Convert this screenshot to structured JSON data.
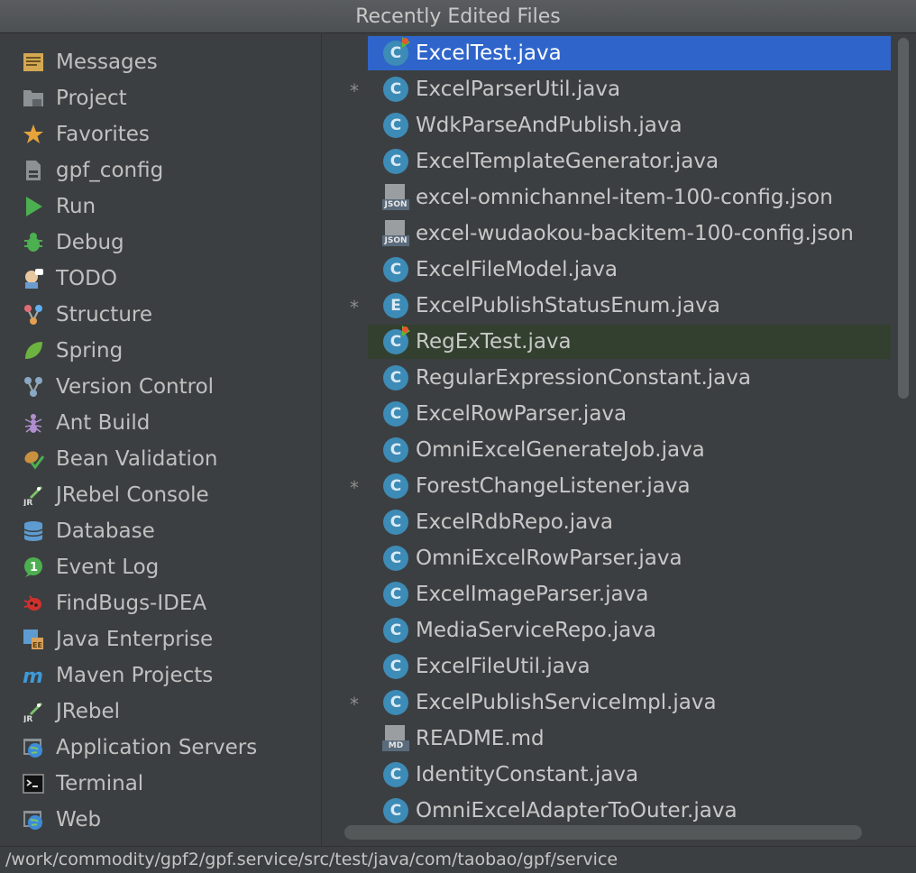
{
  "window": {
    "title": "Recently Edited Files"
  },
  "tool_windows": [
    {
      "label": "Messages",
      "icon": "messages-icon"
    },
    {
      "label": "Project",
      "icon": "project-icon"
    },
    {
      "label": "Favorites",
      "icon": "favorites-star-icon"
    },
    {
      "label": "gpf_config",
      "icon": "database-file-icon"
    },
    {
      "label": "Run",
      "icon": "run-icon"
    },
    {
      "label": "Debug",
      "icon": "debug-bug-icon"
    },
    {
      "label": "TODO",
      "icon": "todo-icon"
    },
    {
      "label": "Structure",
      "icon": "structure-icon"
    },
    {
      "label": "Spring",
      "icon": "spring-leaf-icon"
    },
    {
      "label": "Version Control",
      "icon": "version-control-icon"
    },
    {
      "label": "Ant Build",
      "icon": "ant-icon"
    },
    {
      "label": "Bean Validation",
      "icon": "bean-validation-icon"
    },
    {
      "label": "JRebel Console",
      "icon": "jrebel-console-icon"
    },
    {
      "label": "Database",
      "icon": "database-icon"
    },
    {
      "label": "Event Log",
      "icon": "event-log-icon"
    },
    {
      "label": "FindBugs-IDEA",
      "icon": "findbugs-icon"
    },
    {
      "label": "Java Enterprise",
      "icon": "java-enterprise-icon"
    },
    {
      "label": "Maven Projects",
      "icon": "maven-icon"
    },
    {
      "label": "JRebel",
      "icon": "jrebel-icon"
    },
    {
      "label": "Application Servers",
      "icon": "application-servers-icon"
    },
    {
      "label": "Terminal",
      "icon": "terminal-icon"
    },
    {
      "label": "Web",
      "icon": "web-icon"
    }
  ],
  "files": [
    {
      "name": "ExcelTest.java",
      "kind": "class-run",
      "modified": false,
      "state": "selected"
    },
    {
      "name": "ExcelParserUtil.java",
      "kind": "class",
      "modified": true,
      "state": ""
    },
    {
      "name": "WdkParseAndPublish.java",
      "kind": "class",
      "modified": false,
      "state": ""
    },
    {
      "name": "ExcelTemplateGenerator.java",
      "kind": "class",
      "modified": false,
      "state": ""
    },
    {
      "name": "excel-omnichannel-item-100-config.json",
      "kind": "json",
      "modified": false,
      "state": ""
    },
    {
      "name": "excel-wudaokou-backitem-100-config.json",
      "kind": "json",
      "modified": false,
      "state": ""
    },
    {
      "name": "ExcelFileModel.java",
      "kind": "class",
      "modified": false,
      "state": ""
    },
    {
      "name": "ExcelPublishStatusEnum.java",
      "kind": "enum",
      "modified": true,
      "state": ""
    },
    {
      "name": "RegExTest.java",
      "kind": "class-run",
      "modified": false,
      "state": "current"
    },
    {
      "name": "RegularExpressionConstant.java",
      "kind": "class",
      "modified": false,
      "state": ""
    },
    {
      "name": "ExcelRowParser.java",
      "kind": "class",
      "modified": false,
      "state": ""
    },
    {
      "name": "OmniExcelGenerateJob.java",
      "kind": "class",
      "modified": false,
      "state": ""
    },
    {
      "name": "ForestChangeListener.java",
      "kind": "class",
      "modified": true,
      "state": ""
    },
    {
      "name": "ExcelRdbRepo.java",
      "kind": "class",
      "modified": false,
      "state": ""
    },
    {
      "name": "OmniExcelRowParser.java",
      "kind": "class",
      "modified": false,
      "state": ""
    },
    {
      "name": "ExcelImageParser.java",
      "kind": "class",
      "modified": false,
      "state": ""
    },
    {
      "name": "MediaServiceRepo.java",
      "kind": "class",
      "modified": false,
      "state": ""
    },
    {
      "name": "ExcelFileUtil.java",
      "kind": "class",
      "modified": false,
      "state": ""
    },
    {
      "name": "ExcelPublishServiceImpl.java",
      "kind": "class",
      "modified": true,
      "state": ""
    },
    {
      "name": "README.md",
      "kind": "md",
      "modified": false,
      "state": ""
    },
    {
      "name": "IdentityConstant.java",
      "kind": "class",
      "modified": false,
      "state": ""
    },
    {
      "name": "OmniExcelAdapterToOuter.java",
      "kind": "class",
      "modified": false,
      "state": ""
    }
  ],
  "modified_marker": "*",
  "icon_letters": {
    "class": "C",
    "enum": "E",
    "json": "JSON",
    "md": "MD"
  },
  "status": {
    "path": "/work/commodity/gpf2/gpf.service/src/test/java/com/taobao/gpf/service"
  },
  "colors": {
    "background": "#3c3f41",
    "selection": "#2f65ca",
    "current_row": "#33402f",
    "class_icon": "#3d8bb7"
  }
}
